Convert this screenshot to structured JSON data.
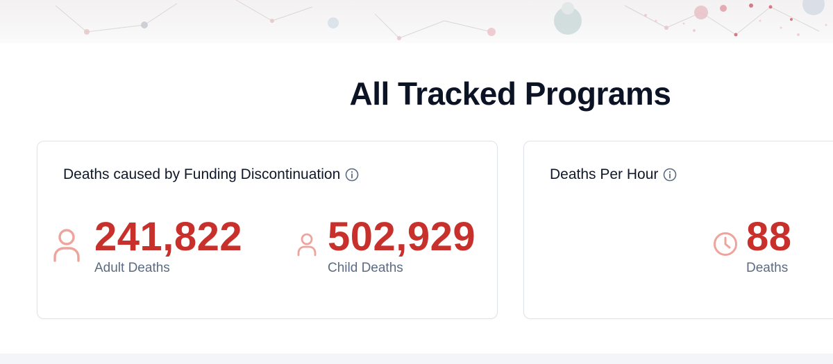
{
  "page": {
    "title": "All Tracked Programs"
  },
  "funding_card": {
    "title": "Deaths caused by Funding Discontinuation",
    "info_icon": "info-circle-icon",
    "adult": {
      "icon": "person-icon",
      "value": "241,822",
      "label": "Adult Deaths"
    },
    "child": {
      "icon": "person-icon",
      "value": "502,929",
      "label": "Child Deaths"
    }
  },
  "hour_card": {
    "title": "Deaths Per Hour",
    "info_icon": "info-circle-icon",
    "stat": {
      "icon": "clock-icon",
      "value": "88",
      "label": "Deaths"
    }
  },
  "colors": {
    "accent_red": "#c8302c",
    "icon_pink": "#eea39c",
    "label_slate": "#5b6b82",
    "title_dark": "#0b1324"
  }
}
